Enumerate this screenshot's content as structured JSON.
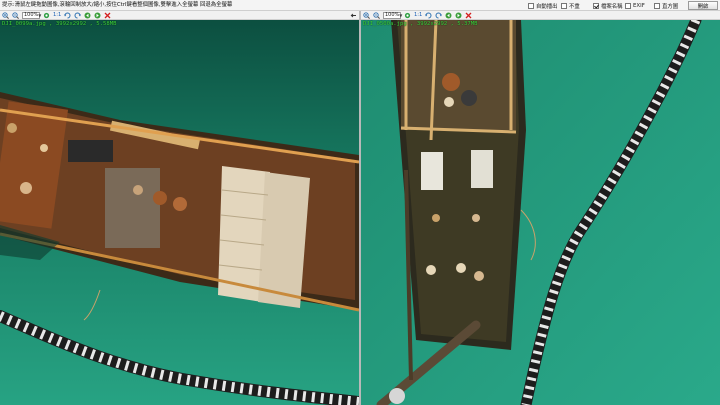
{
  "hint": "提示:滑鼠左鍵拖動圖像,滾輪回制放大/縮小,按住Ctrl鍵看整個圖像,雙擊進入全螢幕 回退為全螢幕",
  "options": [
    {
      "label": "自動播出",
      "checked": false
    },
    {
      "label": "不重",
      "checked": false
    },
    {
      "label": "檔案名稱",
      "checked": true
    },
    {
      "label": "EXIF",
      "checked": false
    },
    {
      "label": "直方圖",
      "checked": false
    }
  ],
  "open_label": "開啟",
  "left_pane": {
    "zoom": "100%",
    "ratio_label": "1:1",
    "file_info": "DJI_0099a.jpg , 3992x2992 , 5.58MB"
  },
  "right_pane": {
    "zoom": "100%",
    "ratio_label": "1:1",
    "file_info": "DJI_0500a.jpg , 3992x2992 , 5.37MB"
  },
  "icons": {
    "back": "back-arrow-icon",
    "forward": "forward-arrow-icon",
    "zoom_in": "zoom-in-icon",
    "zoom_out": "zoom-out-icon",
    "fit": "fit-view-icon",
    "rotate_left": "rotate-left-icon",
    "rotate_right": "rotate-right-icon",
    "prev": "previous-image-icon",
    "next": "next-image-icon",
    "close": "close-icon"
  },
  "colors": {
    "water": "#1f8f72",
    "water_dark": "#0e5546",
    "barge_rust": "#8b4a22",
    "barge_deck": "#c9a26a",
    "boom_dark": "#2b2b2b",
    "boom_light": "#e8e8e8",
    "info_green": "#3bd63b",
    "close_red": "#d42020",
    "accent_blue": "#1a5fb4"
  }
}
